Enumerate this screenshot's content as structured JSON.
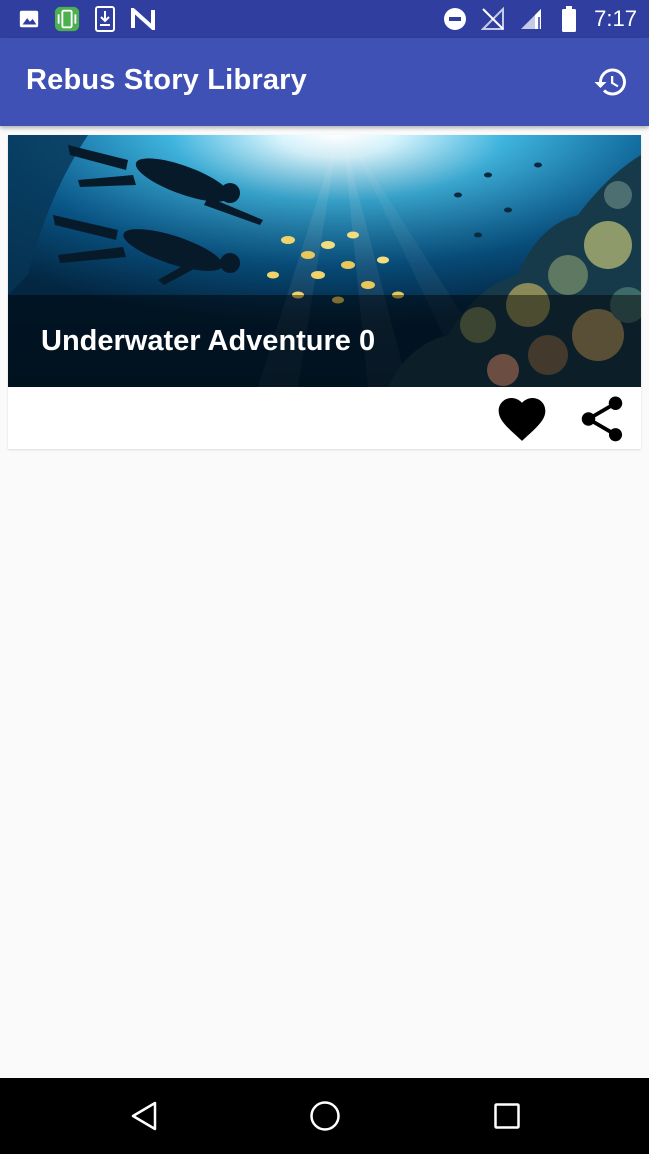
{
  "status_bar": {
    "time": "7:17",
    "left_icons": [
      "image-icon",
      "phone-sync-icon",
      "download-icon",
      "n-logo-icon"
    ],
    "right_icons": [
      "do-not-disturb-icon",
      "no-signal-icon",
      "signal-icon",
      "battery-icon"
    ]
  },
  "app_bar": {
    "title": "Rebus Story Library",
    "action_icon": "history-icon"
  },
  "stories": [
    {
      "title": "Underwater Adventure 0",
      "image": "underwater-scuba-divers-coral-reef",
      "actions": [
        "heart-icon",
        "share-icon"
      ]
    }
  ],
  "nav_bar": {
    "icons": [
      "back-icon",
      "home-icon",
      "recents-icon"
    ]
  },
  "colors": {
    "status_bar": "#303f9f",
    "app_bar": "#3f51b5",
    "background": "#fafafa",
    "card": "#ffffff",
    "nav_bar": "#000000"
  }
}
